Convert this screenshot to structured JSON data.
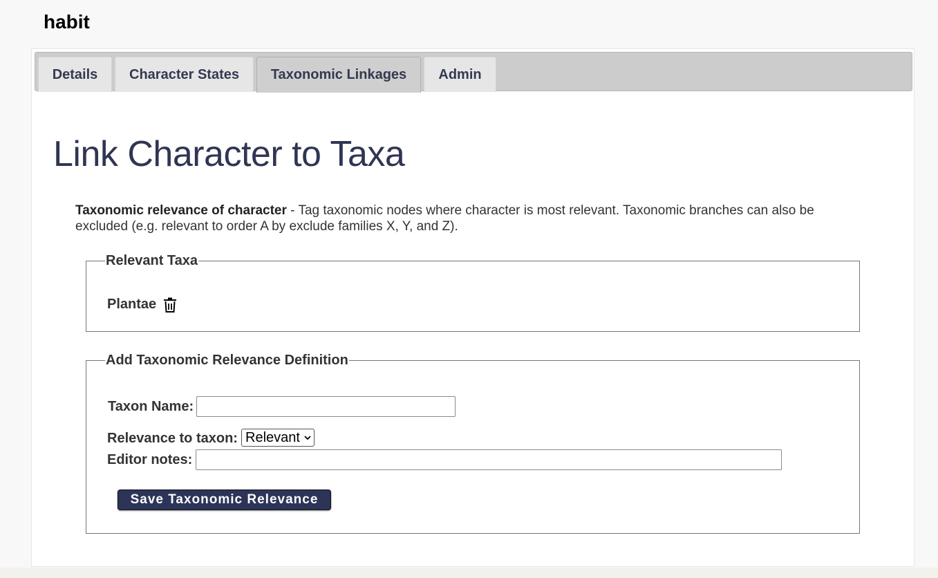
{
  "window": {
    "title": "habit"
  },
  "tabs": [
    {
      "label": "Details",
      "active": false
    },
    {
      "label": "Character States",
      "active": false
    },
    {
      "label": "Taxonomic Linkages",
      "active": true
    },
    {
      "label": "Admin",
      "active": false
    }
  ],
  "main": {
    "heading": "Link Character to Taxa",
    "description_bold": "Taxonomic relevance of character",
    "description_text": " - Tag taxonomic nodes where character is most relevant. Taxonomic branches can also be excluded (e.g. relevant to order A by exclude families X, Y, and Z)."
  },
  "relevant_taxa": {
    "legend": "Relevant Taxa",
    "items": [
      {
        "name": "Plantae",
        "icon": "trash-icon"
      }
    ]
  },
  "add_form": {
    "legend": "Add Taxonomic Relevance Definition",
    "taxon_name_label": "Taxon Name:",
    "taxon_name_value": "",
    "relevance_label": "Relevance to taxon:",
    "relevance_selected": "Relevant",
    "editor_notes_label": "Editor notes:",
    "editor_notes_value": "",
    "save_label": "Save Taxonomic Relevance"
  },
  "colors": {
    "accent": "#2c3457",
    "heading": "#2f3553",
    "tab_bar": "#cccccc"
  }
}
